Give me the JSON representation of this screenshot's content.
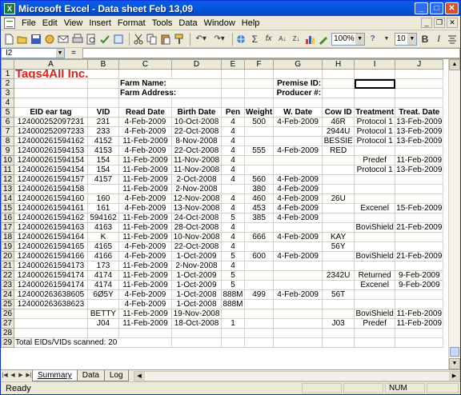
{
  "window": {
    "title": "Microsoft Excel - Data sheet Feb 13,09"
  },
  "menu": [
    "File",
    "Edit",
    "View",
    "Insert",
    "Format",
    "Tools",
    "Data",
    "Window",
    "Help"
  ],
  "toolbar": {
    "zoom": "100%",
    "font_size": "10",
    "bold": "B",
    "italic": "I"
  },
  "formula_bar": {
    "name_box": "I2",
    "equals": "=",
    "formula": ""
  },
  "columns": [
    "A",
    "B",
    "C",
    "D",
    "E",
    "F",
    "G",
    "H",
    "I",
    "J"
  ],
  "sheet": {
    "logo": "Tags4All Inc.",
    "farm_name_label": "Farm Name:",
    "farm_address_label": "Farm Address:",
    "premise_label": "Premise ID:",
    "producer_label": "Producer #:",
    "headers": [
      "EID ear tag",
      "VID",
      "Read Date",
      "Birth Date",
      "Pen",
      "Weight",
      "W. Date",
      "Cow ID",
      "Treatment",
      "Treat. Date"
    ],
    "data_rows": [
      [
        "124000252097231",
        "231",
        "4-Feb-2009",
        "10-Oct-2008",
        "4",
        "500",
        "4-Feb-2009",
        "46R",
        "Protocol 1",
        "13-Feb-2009"
      ],
      [
        "124000252097233",
        "233",
        "4-Feb-2009",
        "22-Oct-2008",
        "4",
        "",
        "",
        "2944U",
        "Protocol 1",
        "13-Feb-2009"
      ],
      [
        "124000261594162",
        "4152",
        "11-Feb-2009",
        "8-Nov-2008",
        "4",
        "",
        "",
        "BESSIE",
        "Protocol 1",
        "13-Feb-2009"
      ],
      [
        "124000261594153",
        "4153",
        "4-Feb-2009",
        "22-Oct-2008",
        "4",
        "555",
        "4-Feb-2009",
        "RED",
        "",
        ""
      ],
      [
        "124000261594154",
        "154",
        "11-Feb-2009",
        "11-Nov-2008",
        "4",
        "",
        "",
        "",
        "Predef",
        "11-Feb-2009"
      ],
      [
        "124000261594154",
        "154",
        "11-Feb-2009",
        "11-Nov-2008",
        "4",
        "",
        "",
        "",
        "Protocol 1",
        "13-Feb-2009"
      ],
      [
        "124000261594157",
        "4157",
        "11-Feb-2009",
        "2-Oct-2008",
        "4",
        "560",
        "4-Feb-2009",
        "",
        "",
        ""
      ],
      [
        "124000261594158",
        "",
        "11-Feb-2009",
        "2-Nov-2008",
        "",
        "380",
        "4-Feb-2009",
        "",
        "",
        ""
      ],
      [
        "124000261594160",
        "160",
        "4-Feb-2009",
        "12-Nov-2008",
        "4",
        "460",
        "4-Feb-2009",
        "26U",
        "",
        ""
      ],
      [
        "124000261594161",
        "161",
        "4-Feb-2009",
        "13-Nov-2008",
        "4",
        "453",
        "4-Feb-2009",
        "",
        "Excenel",
        "15-Feb-2009"
      ],
      [
        "124000261594162",
        "594162",
        "11-Feb-2009",
        "24-Oct-2008",
        "5",
        "385",
        "4-Feb-2009",
        "",
        "",
        ""
      ],
      [
        "124000261594163",
        "4163",
        "11-Feb-2009",
        "28-Oct-2008",
        "4",
        "",
        "",
        "",
        "BoviShield",
        "21-Feb-2009"
      ],
      [
        "124000261594164",
        "K",
        "11-Feb-2009",
        "10-Nov-2008",
        "4",
        "666",
        "4-Feb-2009",
        "KAY",
        "",
        ""
      ],
      [
        "124000261594165",
        "4165",
        "4-Feb-2009",
        "22-Oct-2008",
        "4",
        "",
        "",
        "56Y",
        "",
        ""
      ],
      [
        "124000261594166",
        "4166",
        "4-Feb-2009",
        "1-Oct-2009",
        "5",
        "600",
        "4-Feb-2009",
        "",
        "BoviShield",
        "21-Feb-2009"
      ],
      [
        "124000261594173",
        "173",
        "11-Feb-2009",
        "2-Nov-2008",
        "4",
        "",
        "",
        "",
        "",
        ""
      ],
      [
        "124000261594174",
        "4174",
        "11-Feb-2009",
        "1-Oct-2009",
        "5",
        "",
        "",
        "2342U",
        "Returned",
        "9-Feb-2009"
      ],
      [
        "124000261594174",
        "4174",
        "11-Feb-2009",
        "1-Oct-2009",
        "5",
        "",
        "",
        "",
        "Excenel",
        "9-Feb-2009"
      ],
      [
        "124000263638605",
        "6Ø5Y",
        "4-Feb-2009",
        "1-Oct-2008",
        "888M",
        "499",
        "4-Feb-2009",
        "56T",
        "",
        ""
      ],
      [
        "124000263638623",
        "",
        "4-Feb-2009",
        "1-Oct-2008",
        "888M",
        "",
        "",
        "",
        "",
        ""
      ],
      [
        "",
        "BETTY",
        "11-Feb-2009",
        "19-Nov-2008",
        "",
        "",
        "",
        "",
        "BoviShield",
        "11-Feb-2009"
      ],
      [
        "",
        "J04",
        "11-Feb-2009",
        "18-Oct-2008",
        "1",
        "",
        "",
        "J03",
        "Predef",
        "11-Feb-2009"
      ]
    ],
    "total_text": "Total EIDs/VIDs scanned: 20"
  },
  "tabs": [
    "Summary",
    "Data",
    "Log"
  ],
  "active_tab": "Summary",
  "status": {
    "ready": "Ready",
    "num": "NUM"
  }
}
